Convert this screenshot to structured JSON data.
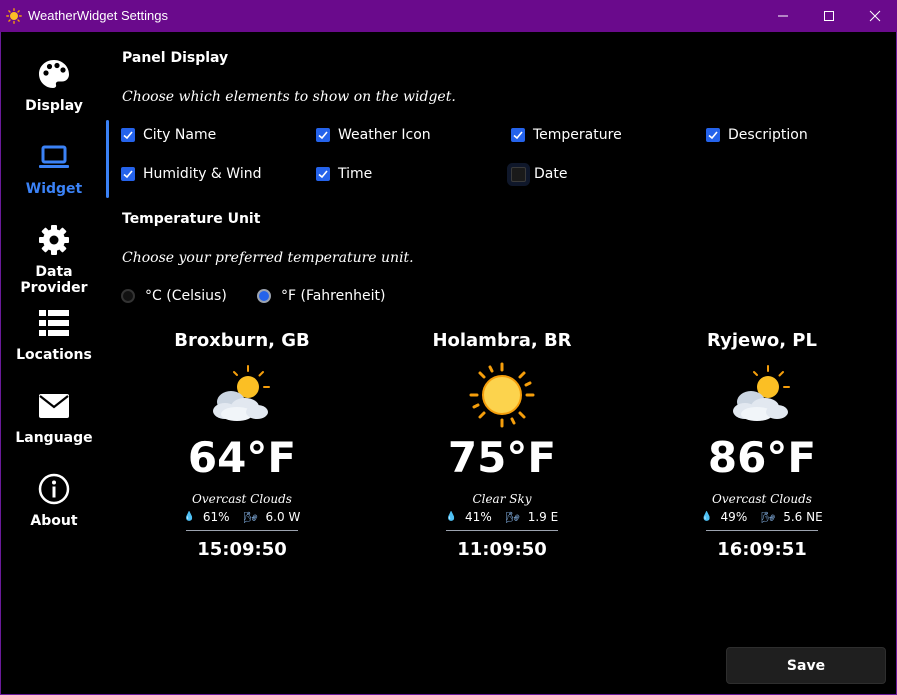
{
  "window": {
    "title": "WeatherWidget Settings"
  },
  "sidebar": {
    "items": [
      {
        "label": "Display",
        "icon": "palette-icon"
      },
      {
        "label": "Widget",
        "icon": "laptop-icon"
      },
      {
        "label": "Data Provider",
        "icon": "gear-icon"
      },
      {
        "label": "Locations",
        "icon": "list-icon"
      },
      {
        "label": "Language",
        "icon": "envelope-icon"
      },
      {
        "label": "About",
        "icon": "info-icon"
      }
    ],
    "active": "Widget"
  },
  "panel_display": {
    "title": "Panel Display",
    "description": "Choose which elements to show on the widget.",
    "options": [
      {
        "label": "City Name",
        "checked": true
      },
      {
        "label": "Weather Icon",
        "checked": true
      },
      {
        "label": "Temperature",
        "checked": true
      },
      {
        "label": "Description",
        "checked": true
      },
      {
        "label": "Humidity & Wind",
        "checked": true
      },
      {
        "label": "Time",
        "checked": true
      },
      {
        "label": "Date",
        "checked": false
      }
    ]
  },
  "temperature_unit": {
    "title": "Temperature Unit",
    "description": "Choose your preferred temperature unit.",
    "options": [
      {
        "label": "°C (Celsius)",
        "selected": false
      },
      {
        "label": "°F (Fahrenheit)",
        "selected": true
      }
    ]
  },
  "previews": [
    {
      "city": "Broxburn, GB",
      "icon": "cloud-sun-icon",
      "temp": "64°F",
      "description": "Overcast Clouds",
      "humidity": "61%",
      "wind": "6.0 W",
      "time": "15:09:50"
    },
    {
      "city": "Holambra, BR",
      "icon": "sun-icon",
      "temp": "75°F",
      "description": "Clear Sky",
      "humidity": "41%",
      "wind": "1.9 E",
      "time": "11:09:50"
    },
    {
      "city": "Ryjewo, PL",
      "icon": "cloud-sun-icon",
      "temp": "86°F",
      "description": "Overcast Clouds",
      "humidity": "49%",
      "wind": "5.6 NE",
      "time": "16:09:51"
    }
  ],
  "save_label": "Save",
  "colors": {
    "titlebar": "#6a0a8c",
    "accent": "#3b82f6",
    "background": "#000000"
  }
}
